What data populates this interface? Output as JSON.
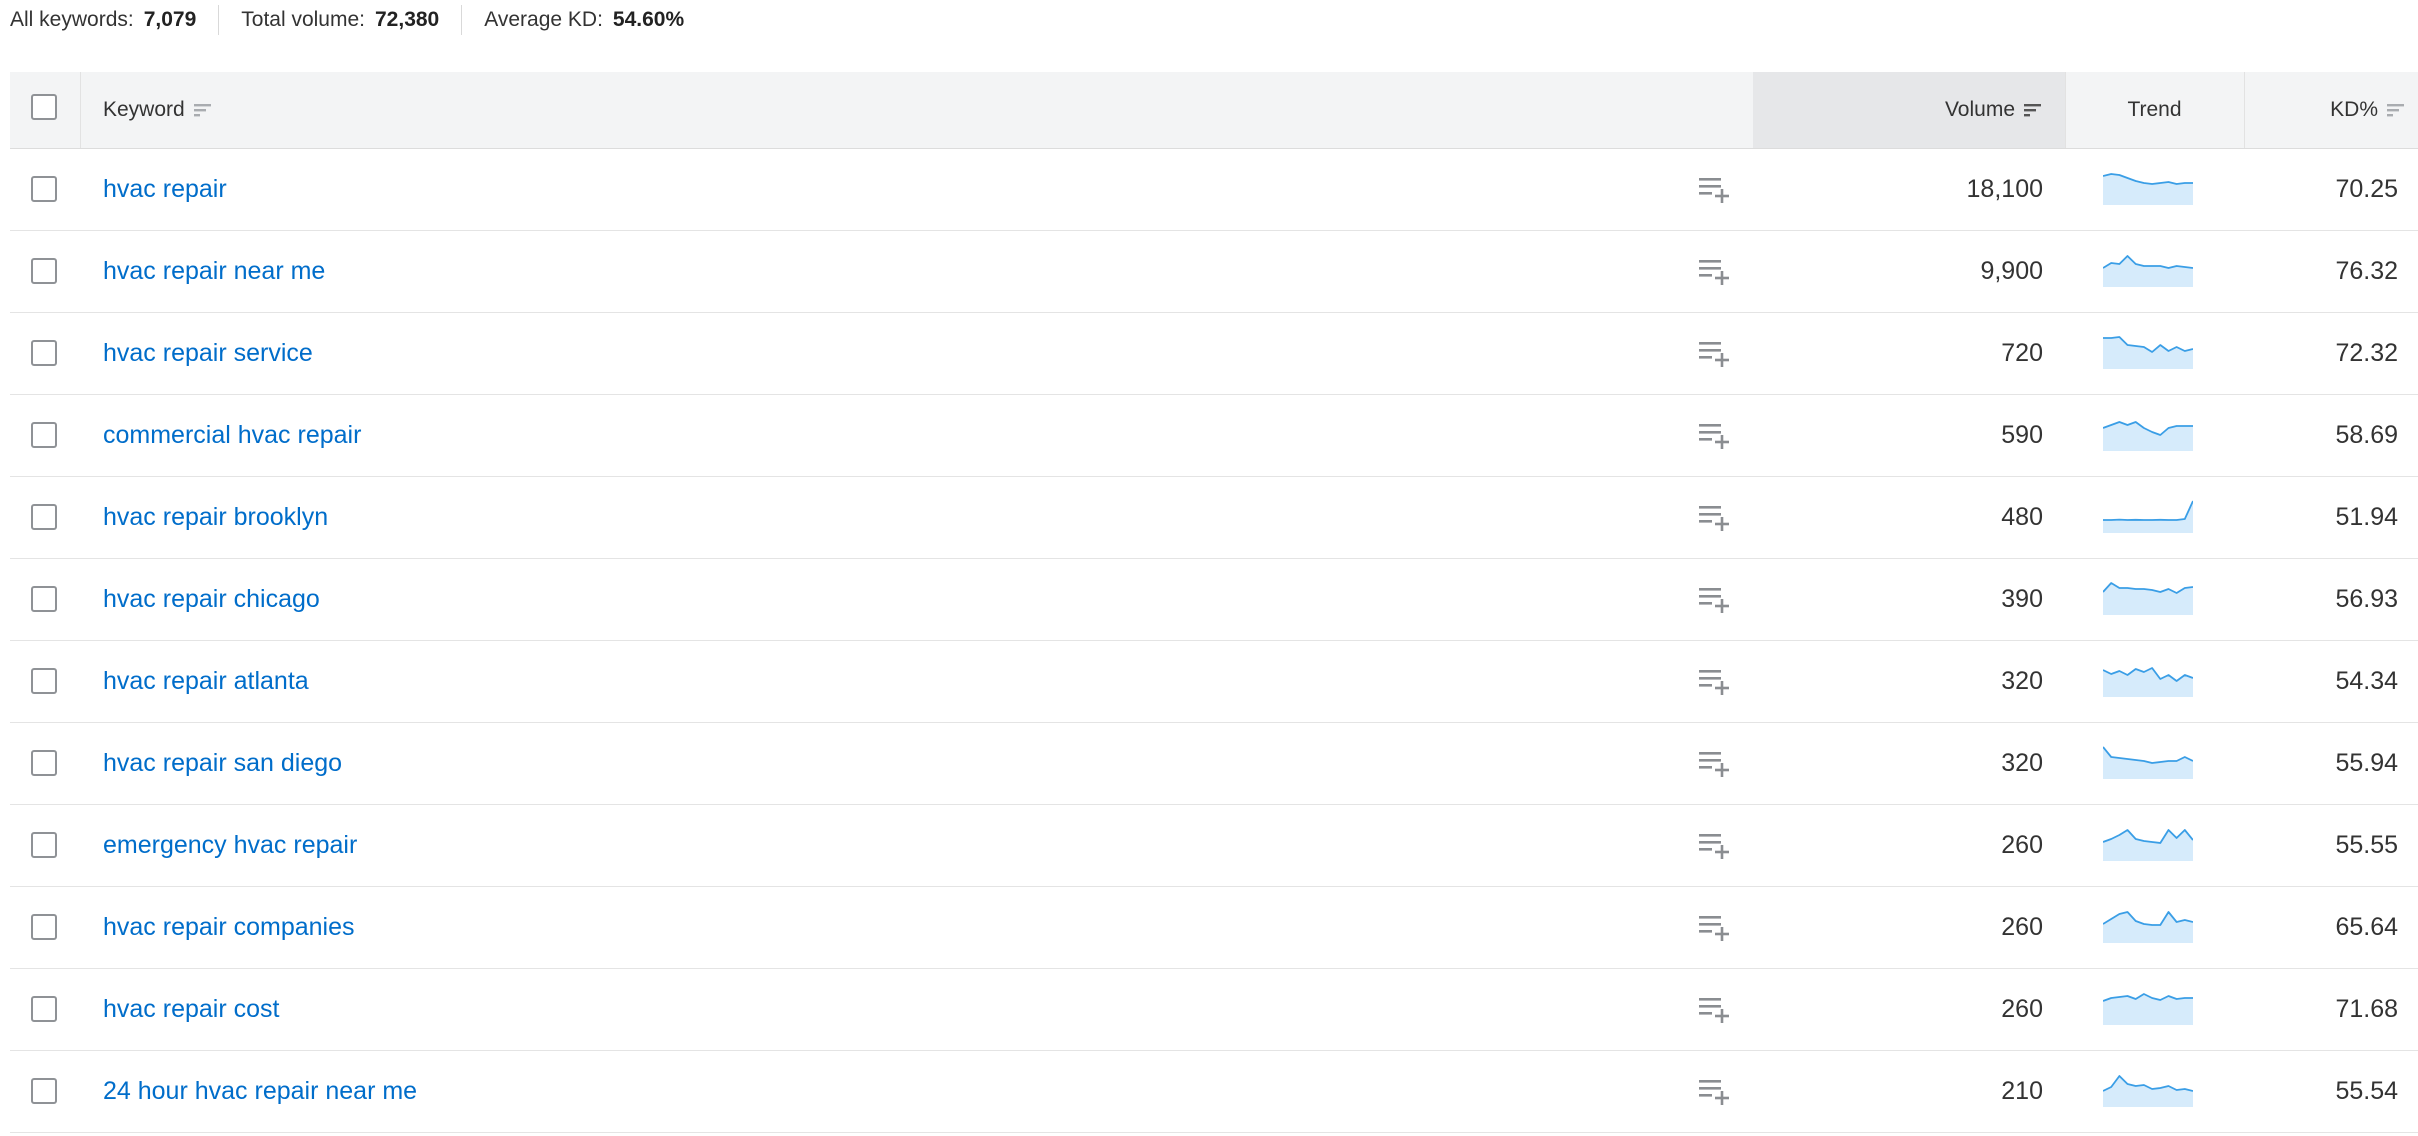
{
  "summary": {
    "all_keywords_label": "All keywords:",
    "all_keywords_value": "7,079",
    "total_volume_label": "Total volume:",
    "total_volume_value": "72,380",
    "avg_kd_label": "Average KD:",
    "avg_kd_value": "54.60%"
  },
  "table": {
    "headers": {
      "keyword": "Keyword",
      "volume": "Volume",
      "trend": "Trend",
      "kd": "KD%"
    },
    "rows": [
      {
        "keyword": "hvac repair",
        "volume": "18,100",
        "kd": "70.25",
        "trend": [
          0.85,
          0.95,
          0.9,
          0.75,
          0.6,
          0.5,
          0.45,
          0.5,
          0.55,
          0.45,
          0.5,
          0.5
        ]
      },
      {
        "keyword": "hvac repair near me",
        "volume": "9,900",
        "kd": "76.32",
        "trend": [
          0.35,
          0.6,
          0.55,
          0.95,
          0.55,
          0.45,
          0.45,
          0.45,
          0.35,
          0.45,
          0.4,
          0.35
        ]
      },
      {
        "keyword": "hvac repair service",
        "volume": "720",
        "kd": "72.32",
        "trend": [
          0.95,
          0.95,
          1.0,
          0.6,
          0.55,
          0.5,
          0.25,
          0.6,
          0.3,
          0.5,
          0.3,
          0.4
        ]
      },
      {
        "keyword": "commercial hvac repair",
        "volume": "590",
        "kd": "58.69",
        "trend": [
          0.55,
          0.7,
          0.85,
          0.7,
          0.85,
          0.55,
          0.35,
          0.2,
          0.55,
          0.65,
          0.65,
          0.65
        ]
      },
      {
        "keyword": "hvac repair brooklyn",
        "volume": "480",
        "kd": "51.94",
        "trend": [
          0.05,
          0.05,
          0.07,
          0.05,
          0.06,
          0.05,
          0.05,
          0.06,
          0.05,
          0.05,
          0.1,
          1.0
        ]
      },
      {
        "keyword": "hvac repair chicago",
        "volume": "390",
        "kd": "56.93",
        "trend": [
          0.55,
          1.0,
          0.75,
          0.75,
          0.7,
          0.7,
          0.65,
          0.55,
          0.7,
          0.5,
          0.75,
          0.8
        ]
      },
      {
        "keyword": "hvac repair atlanta",
        "volume": "320",
        "kd": "54.34",
        "trend": [
          0.75,
          0.55,
          0.7,
          0.5,
          0.8,
          0.65,
          0.85,
          0.3,
          0.5,
          0.2,
          0.5,
          0.35
        ]
      },
      {
        "keyword": "hvac repair san diego",
        "volume": "320",
        "kd": "55.94",
        "trend": [
          1.0,
          0.5,
          0.45,
          0.4,
          0.35,
          0.3,
          0.2,
          0.25,
          0.3,
          0.3,
          0.5,
          0.3
        ]
      },
      {
        "keyword": "emergency hvac repair",
        "volume": "260",
        "kd": "55.55",
        "trend": [
          0.35,
          0.5,
          0.7,
          0.95,
          0.5,
          0.4,
          0.35,
          0.3,
          0.95,
          0.55,
          0.95,
          0.45
        ]
      },
      {
        "keyword": "hvac repair companies",
        "volume": "260",
        "kd": "65.64",
        "trend": [
          0.35,
          0.6,
          0.85,
          0.95,
          0.5,
          0.35,
          0.3,
          0.3,
          0.95,
          0.45,
          0.55,
          0.45
        ]
      },
      {
        "keyword": "hvac repair cost",
        "volume": "260",
        "kd": "71.68",
        "trend": [
          0.6,
          0.75,
          0.8,
          0.85,
          0.7,
          0.95,
          0.75,
          0.65,
          0.85,
          0.7,
          0.75,
          0.75
        ]
      },
      {
        "keyword": "24 hour hvac repair near me",
        "volume": "210",
        "kd": "55.54",
        "trend": [
          0.2,
          0.4,
          0.95,
          0.55,
          0.45,
          0.5,
          0.3,
          0.35,
          0.45,
          0.25,
          0.3,
          0.2
        ]
      }
    ]
  }
}
